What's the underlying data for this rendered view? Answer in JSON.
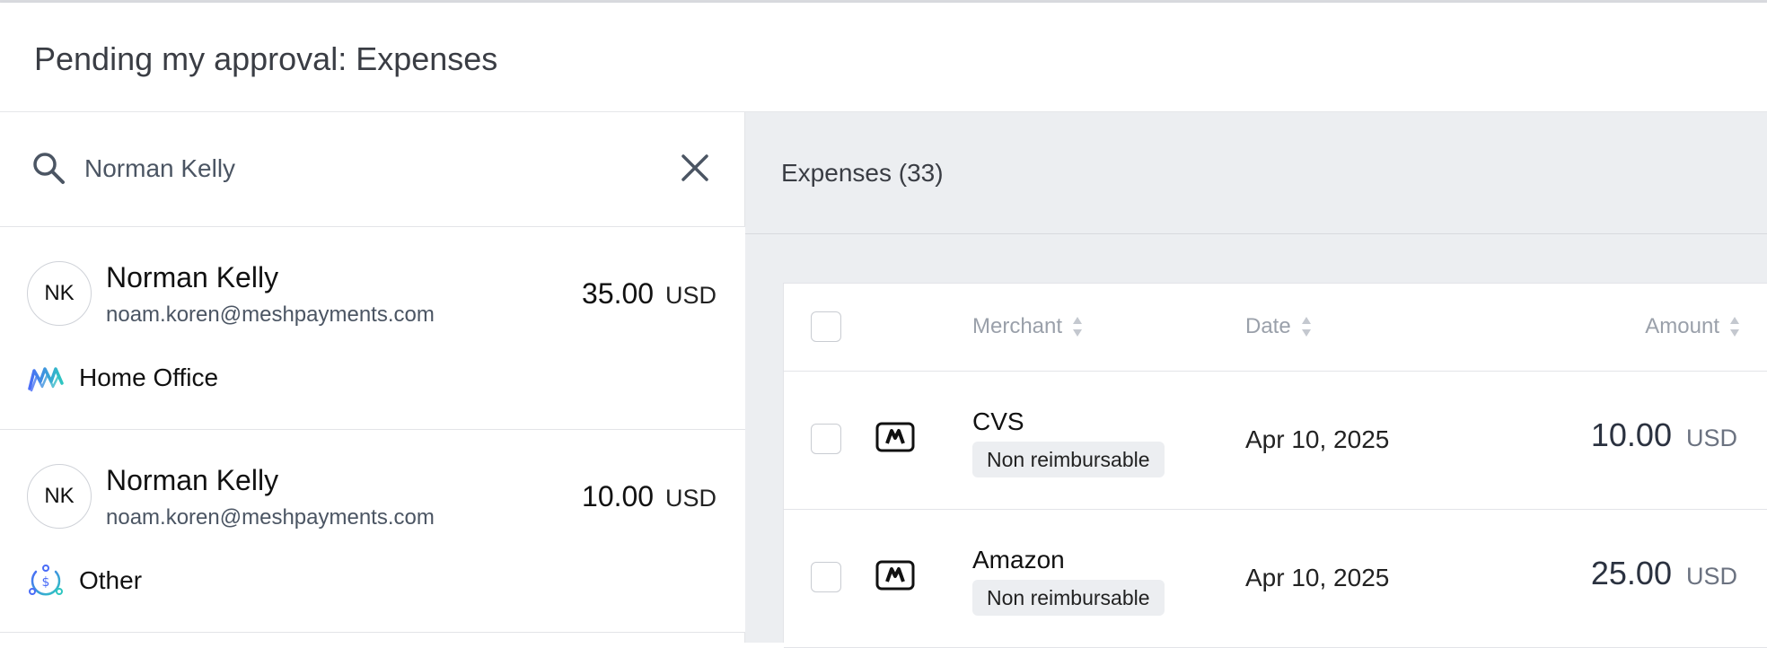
{
  "header": {
    "title": "Pending my approval: Expenses"
  },
  "search": {
    "value": "Norman Kelly"
  },
  "requests": [
    {
      "initials": "NK",
      "name": "Norman Kelly",
      "email": "noam.koren@meshpayments.com",
      "amount": "35.00",
      "currency": "USD",
      "category": "Home Office",
      "category_icon": "home-office-icon"
    },
    {
      "initials": "NK",
      "name": "Norman Kelly",
      "email": "noam.koren@meshpayments.com",
      "amount": "10.00",
      "currency": "USD",
      "category": "Other",
      "category_icon": "other-dollar-icon"
    }
  ],
  "expenses": {
    "title": "Expenses (33)",
    "columns": {
      "merchant": "Merchant",
      "date": "Date",
      "amount": "Amount"
    },
    "rows": [
      {
        "merchant": "CVS",
        "tag": "Non reimbursable",
        "date": "Apr 10, 2025",
        "amount": "10.00",
        "currency": "USD"
      },
      {
        "merchant": "Amazon",
        "tag": "Non reimbursable",
        "date": "Apr 10, 2025",
        "amount": "25.00",
        "currency": "USD"
      }
    ]
  },
  "colors": {
    "accent_blue": "#4a6cf7",
    "accent_teal": "#2fc6c0",
    "panel_gray": "#eceef1"
  }
}
